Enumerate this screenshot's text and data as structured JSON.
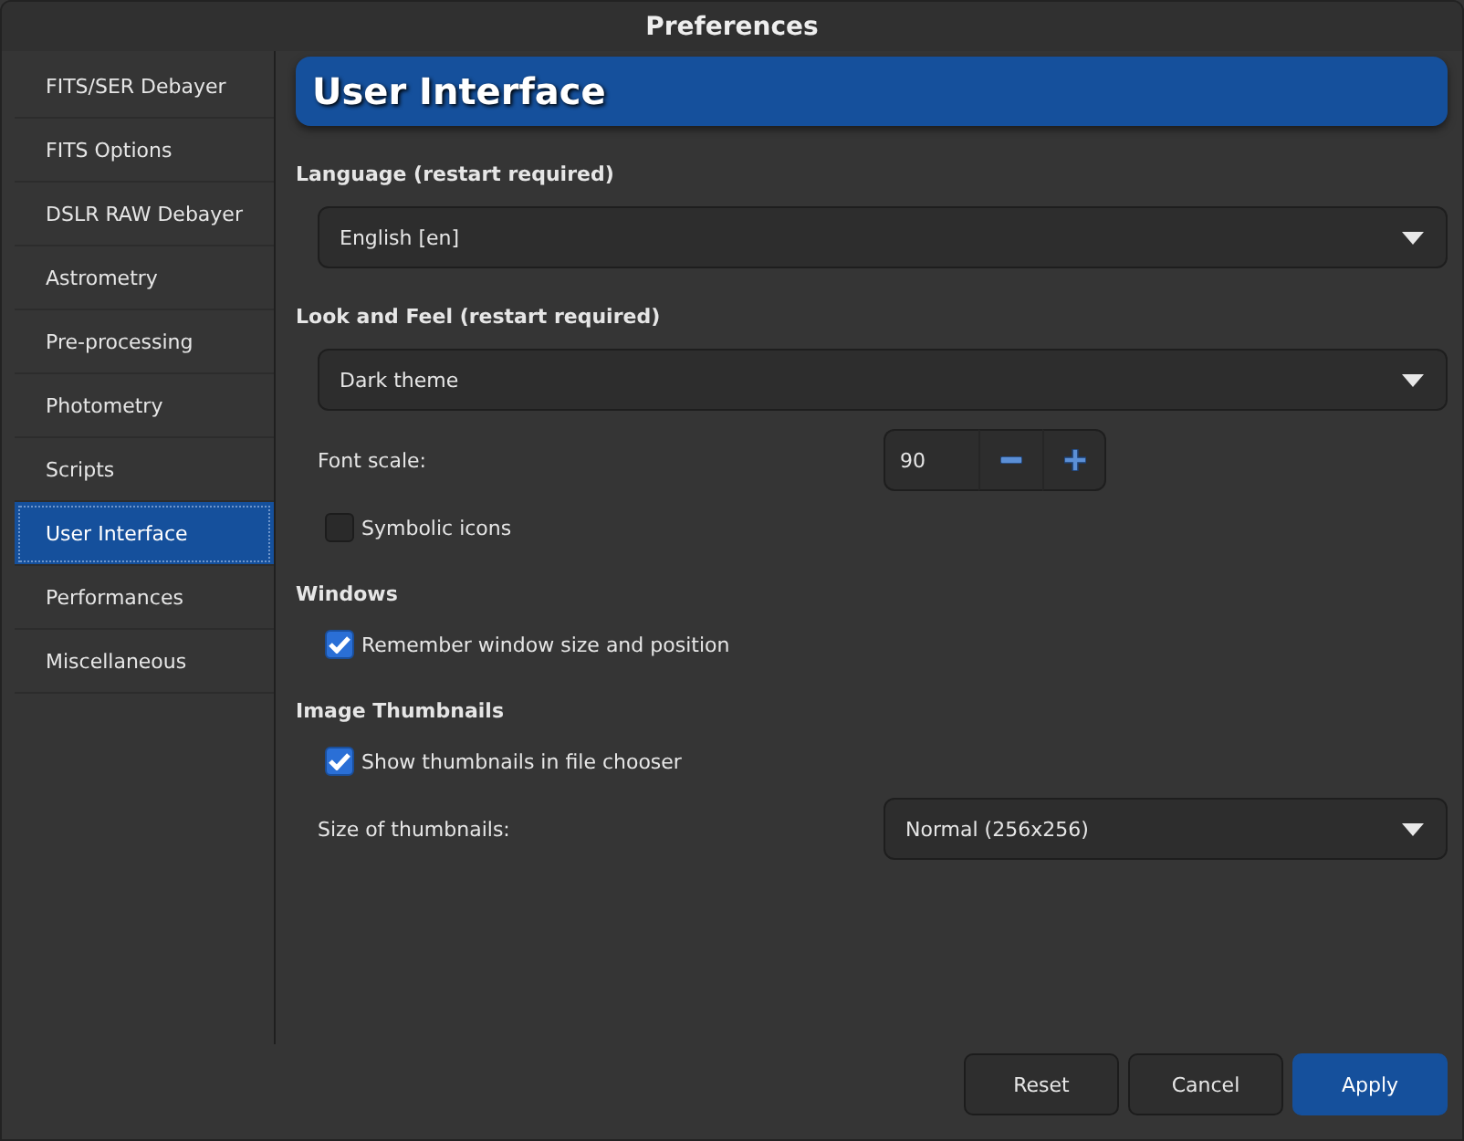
{
  "window": {
    "title": "Preferences"
  },
  "sidebar": {
    "items": [
      {
        "label": "FITS/SER Debayer",
        "selected": false
      },
      {
        "label": "FITS Options",
        "selected": false
      },
      {
        "label": "DSLR RAW Debayer",
        "selected": false
      },
      {
        "label": "Astrometry",
        "selected": false
      },
      {
        "label": "Pre-processing",
        "selected": false
      },
      {
        "label": "Photometry",
        "selected": false
      },
      {
        "label": "Scripts",
        "selected": false
      },
      {
        "label": "User Interface",
        "selected": true
      },
      {
        "label": "Performances",
        "selected": false
      },
      {
        "label": "Miscellaneous",
        "selected": false
      }
    ]
  },
  "page": {
    "title": "User Interface",
    "sections": [
      {
        "heading": "Language (restart required)",
        "rows": [
          {
            "kind": "dropdown",
            "value": "English [en]"
          }
        ]
      },
      {
        "heading": "Look and Feel (restart required)",
        "rows": [
          {
            "kind": "dropdown",
            "value": "Dark theme"
          },
          {
            "kind": "spin",
            "label": "Font scale:",
            "value": "90"
          },
          {
            "kind": "checkbox",
            "label": "Symbolic icons",
            "checked": false
          }
        ]
      },
      {
        "heading": "Windows",
        "rows": [
          {
            "kind": "checkbox",
            "label": "Remember window size and position",
            "checked": true
          }
        ]
      },
      {
        "heading": "Image Thumbnails",
        "rows": [
          {
            "kind": "checkbox",
            "label": "Show thumbnails in file chooser",
            "checked": true
          },
          {
            "kind": "labeled-dropdown",
            "label": "Size of thumbnails:",
            "value": "Normal (256x256)"
          }
        ]
      }
    ]
  },
  "buttons": [
    {
      "label": "Reset",
      "kind": "normal"
    },
    {
      "label": "Cancel",
      "kind": "normal"
    },
    {
      "label": "Apply",
      "kind": "primary"
    }
  ]
}
